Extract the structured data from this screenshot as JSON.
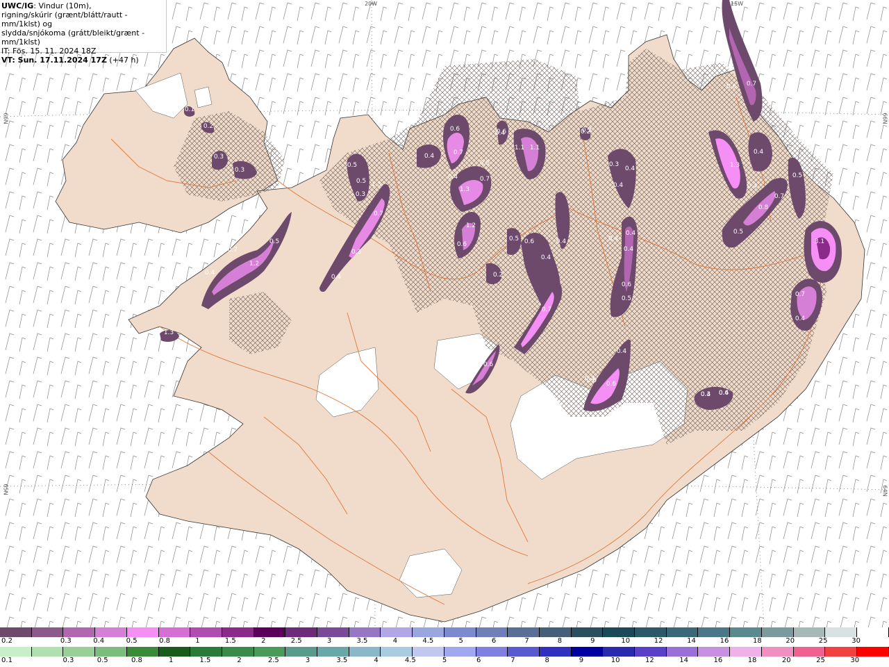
{
  "header": {
    "model": "UWC/IG",
    "line1_rest": ": Vindur (10m),",
    "line2": "rigning/skúrir (grænt/blátt/rautt - mm/1klst) og",
    "line3": "slydda/snjókoma (grátt/bleikt/grænt - mm/1klst)",
    "it": "IT: Fös. 15. 11. 2024 18Z",
    "vt_bold": "VT: Sun. 17.11.2024 17Z",
    "vt_rest": " (+47 h)"
  },
  "grid_labels": {
    "top_20w": "20W",
    "top_15w": "15W",
    "left_66n": "66N",
    "right_66n": "66N",
    "left_65n": "65N",
    "right_64n": "64N"
  },
  "precip_values": [
    "0.1",
    "0.2",
    "0.3",
    "0.3",
    "0.4",
    "0.7",
    "1.2",
    "0.5",
    "0.4",
    "0.3",
    "1.3",
    "0.5",
    "0.5",
    "0.3",
    "1.3",
    "0.7",
    "0.5",
    "0.6",
    "0.7",
    "0.4",
    "0.4",
    "0.4",
    "1.3",
    "0.7",
    "1.2",
    "0.6",
    "1.1",
    "0.6",
    "1.1",
    "0.5",
    "0.6",
    "0.4",
    "0.4",
    "0.2",
    "0.7",
    "0.6",
    "0.2",
    "0.3",
    "0.4",
    "0.4",
    "0.4",
    "0.4",
    "0.4",
    "0.4",
    "0.6",
    "0.5",
    "0.6",
    "1.3",
    "0.4",
    "0.4",
    "0.6",
    "0.7",
    "0.7",
    "0.8",
    "0.5",
    "0.5",
    "3.1",
    "0.7",
    "0.4",
    "0.6",
    "0.4",
    "0.2",
    "0.6",
    "0.3",
    "0.4",
    "0.2"
  ],
  "colorbar_snow": {
    "colors": [
      "#6d4a6b",
      "#8b5a8a",
      "#b266b2",
      "#d67fd6",
      "#f58ef5",
      "#d46fd4",
      "#b04db0",
      "#8c2a8c",
      "#5a005a",
      "#6e2a7a",
      "#7a4a9a",
      "#9577c5",
      "#b2a6e6",
      "#9aa6e0",
      "#7d8ad0",
      "#6f80b8",
      "#5a6f98",
      "#465f78",
      "#2a5060",
      "#1a4a58",
      "#2a5a68",
      "#3a6878",
      "#4a7888",
      "#5a8a8e",
      "#7a9a9e",
      "#a6b8b8",
      "#d8e2e2",
      "#ffffff"
    ],
    "labels": [
      "0.2",
      "0.3",
      "0.4",
      "0.5",
      "0.8",
      "1",
      "1.5",
      "2",
      "2.5",
      "3",
      "3.5",
      "4",
      "4.5",
      "5",
      "6",
      "7",
      "8",
      "9",
      "10",
      "12",
      "14",
      "16",
      "18",
      "20",
      "25",
      "30"
    ]
  },
  "colorbar_rain": {
    "colors": [
      "#c8f0c8",
      "#b0e0b0",
      "#98d098",
      "#7cbc7c",
      "#3a8a3a",
      "#1a5a1a",
      "#2a7a3a",
      "#3a8a4a",
      "#4a9a5a",
      "#5a9a8a",
      "#6aa8a8",
      "#8ab8c8",
      "#aacce0",
      "#c0c8f0",
      "#a0a8f0",
      "#8080e0",
      "#5a5ad0",
      "#3030c0",
      "#0000a0",
      "#2a2ab0",
      "#5a40c8",
      "#9a70d8",
      "#c890e0",
      "#f0b0e8",
      "#f090c0",
      "#f06090",
      "#f04040",
      "#ff0000"
    ],
    "labels": [
      "0.1",
      "0.3",
      "0.5",
      "0.8",
      "1",
      "1.5",
      "2",
      "2.5",
      "3",
      "3.5",
      "4",
      "4.5",
      "5",
      "6",
      "7",
      "8",
      "9",
      "10",
      "12",
      "14",
      "16",
      "18",
      "20",
      "25",
      "30"
    ]
  }
}
